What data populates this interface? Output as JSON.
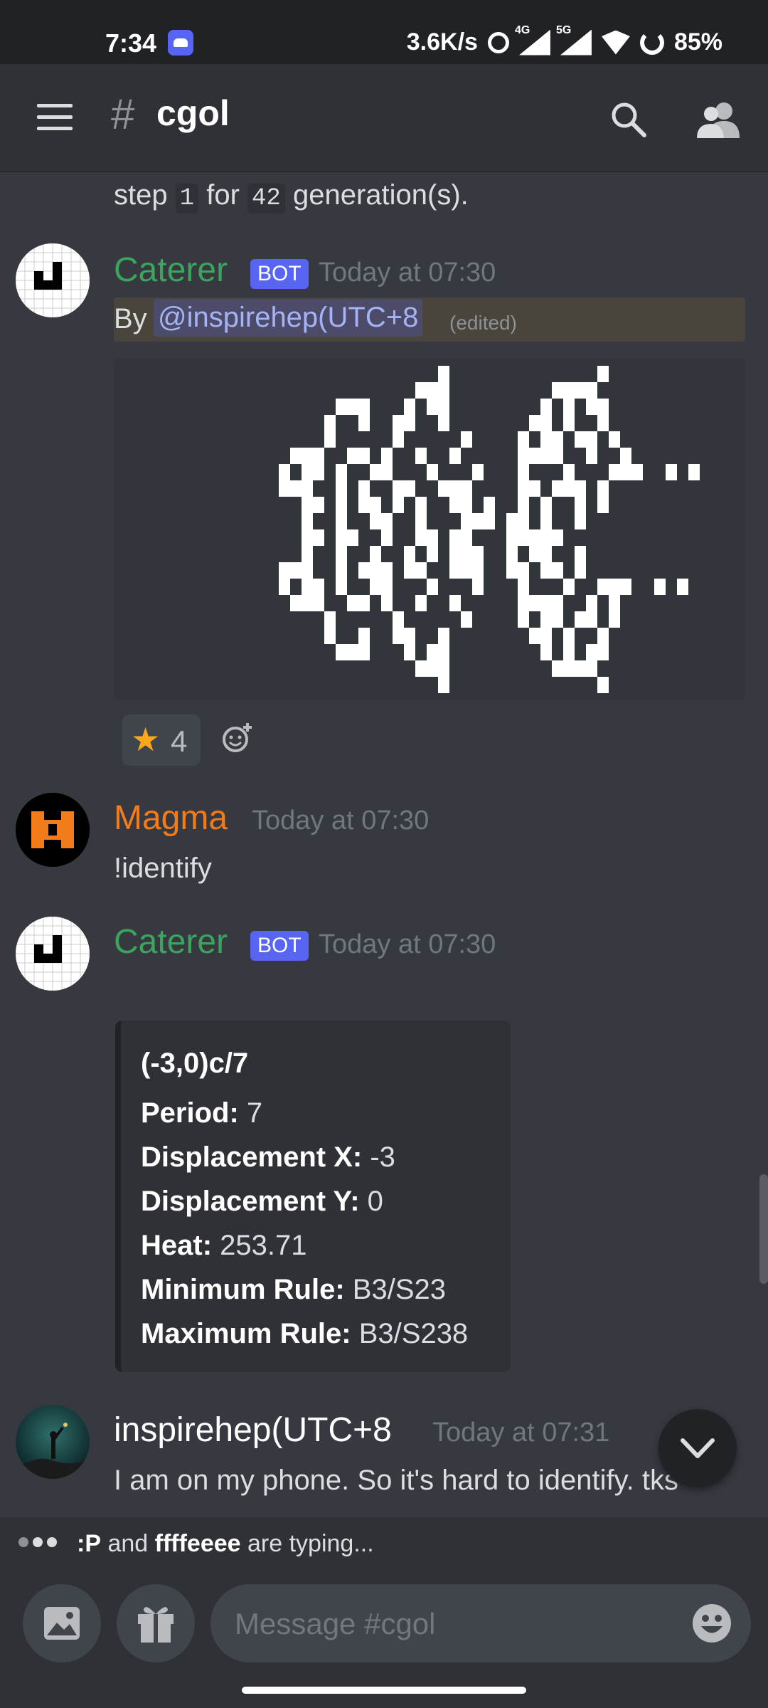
{
  "status_bar": {
    "time": "7:34",
    "net_speed": "3.6K/s",
    "net_4g": "4G",
    "net_5g": "5G",
    "battery": "85%"
  },
  "app_bar": {
    "hash": "#",
    "channel": "cgol"
  },
  "messages": {
    "prev_tail": {
      "text_pre": "step ",
      "code1": "1",
      "text_mid": " for ",
      "code2": "42",
      "text_post": " generation(s)."
    },
    "m1": {
      "author": "Caterer",
      "author_color": "#3ba55d",
      "bot_tag": "BOT",
      "timestamp": "Today at 07:30",
      "by": "By",
      "mention": "@inspirehep(UTC+8",
      "edited": "(edited)",
      "reaction_emoji": "★",
      "reaction_count": "4"
    },
    "m2": {
      "author": "Magma",
      "author_color": "#f47b1a",
      "timestamp": "Today at 07:30",
      "text": "!identify"
    },
    "m3": {
      "author": "Caterer",
      "bot_tag": "BOT",
      "timestamp": "Today at 07:30",
      "embed": {
        "title": "(-3,0)c/7",
        "fields": [
          {
            "label": "Period:",
            "value": " 7"
          },
          {
            "label": "Displacement X:",
            "value": " -3"
          },
          {
            "label": "Displacement Y:",
            "value": " 0"
          },
          {
            "label": "Heat:",
            "value": " 253.71"
          },
          {
            "label": "Minimum Rule:",
            "value": " B3/S23"
          },
          {
            "label": "Maximum Rule:",
            "value": " B3/S238"
          }
        ]
      }
    },
    "m4": {
      "author": "inspirehep(UTC+8",
      "timestamp": "Today at 07:31",
      "text": "I am on my phone. So it's hard to identify. tks"
    }
  },
  "typing": {
    "user1": ":P",
    "and": " and ",
    "user2": "ffffeeee",
    "suffix": " are typing..."
  },
  "composer": {
    "placeholder": "Message #cgol"
  }
}
